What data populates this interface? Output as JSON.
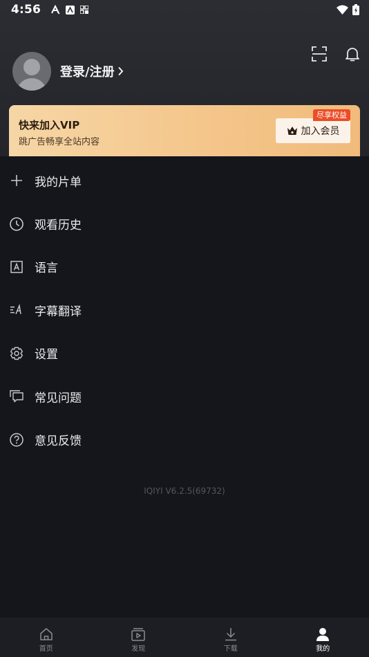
{
  "status_bar": {
    "time": "4:56"
  },
  "profile": {
    "login_label": "登录/注册"
  },
  "vip": {
    "title": "快来加入VIP",
    "subtitle": "跳广告畅享全站内容",
    "tag": "尽享权益",
    "button_label": "加入会员",
    "gradient_start": "#f6d6a6",
    "gradient_end": "#f0bb7b",
    "tag_color": "#ec4c26"
  },
  "menu": {
    "items": [
      {
        "label": "我的片单",
        "icon": "plus-icon"
      },
      {
        "label": "观看历史",
        "icon": "clock-icon"
      },
      {
        "label": "语言",
        "icon": "language-icon"
      },
      {
        "label": "字幕翻译",
        "icon": "subtitle-translate-icon"
      },
      {
        "label": "设置",
        "icon": "gear-icon"
      },
      {
        "label": "常见问题",
        "icon": "chat-bubbles-icon"
      },
      {
        "label": "意见反馈",
        "icon": "question-icon"
      }
    ]
  },
  "version": "IQIYI V6.2.5(69732)",
  "tabbar": {
    "tabs": [
      {
        "label": "首页",
        "icon": "home-icon",
        "active": false
      },
      {
        "label": "发现",
        "icon": "play-box-icon",
        "active": false
      },
      {
        "label": "下载",
        "icon": "download-icon",
        "active": false
      },
      {
        "label": "我的",
        "icon": "person-icon",
        "active": true
      }
    ]
  }
}
